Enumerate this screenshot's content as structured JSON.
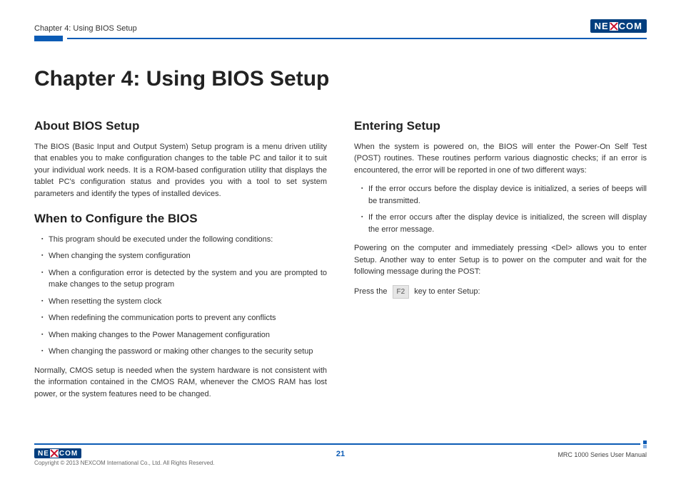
{
  "header": {
    "breadcrumb": "Chapter 4: Using BIOS Setup",
    "logo_pre": "NE",
    "logo_post": "COM"
  },
  "title": "Chapter 4: Using BIOS Setup",
  "left": {
    "h_about": "About BIOS Setup",
    "p_about": "The BIOS (Basic Input and Output System) Setup program is a menu driven utility that enables you to make configuration changes to the table PC and tailor it to suit your individual work needs. It is a ROM-based configuration utility that displays the tablet PC's configuration status and provides you with a tool to set system parameters and identify the types of installed devices.",
    "h_when": "When to Configure the BIOS",
    "when_items": [
      "This program should be executed under the following conditions:",
      "When changing the system configuration",
      "When a configuration error is detected by the system and you are prompted to make changes to the setup program",
      "When resetting the system clock",
      "When redefining the communication ports to prevent any conflicts",
      "When making changes to the Power Management configuration",
      "When changing the password or making other changes to the security setup"
    ],
    "p_when_tail": "Normally, CMOS setup is needed when the system hardware is not consistent with the information contained in the CMOS RAM, whenever the CMOS RAM has lost power, or the system features need to be changed."
  },
  "right": {
    "h_enter": "Entering Setup",
    "p_enter1": "When the system is powered on, the BIOS will enter the Power-On Self Test (POST) routines. These routines perform various diagnostic checks; if an error is encountered, the error will be reported in one of two different ways:",
    "enter_items": [
      "If the error occurs before the display device is initialized, a series of beeps will be transmitted.",
      "If the error occurs after the display device is initialized, the screen will display the error message."
    ],
    "p_enter2": "Powering on the computer and immediately pressing <Del> allows you to enter Setup. Another way to enter Setup is to power on the computer and wait for the following message during the POST:",
    "press_pre": "Press the",
    "key_label": "F2",
    "press_post": "key to enter Setup:"
  },
  "footer": {
    "copyright": "Copyright © 2013 NEXCOM International Co., Ltd. All Rights Reserved.",
    "page": "21",
    "manual": "MRC 1000 Series User Manual"
  }
}
